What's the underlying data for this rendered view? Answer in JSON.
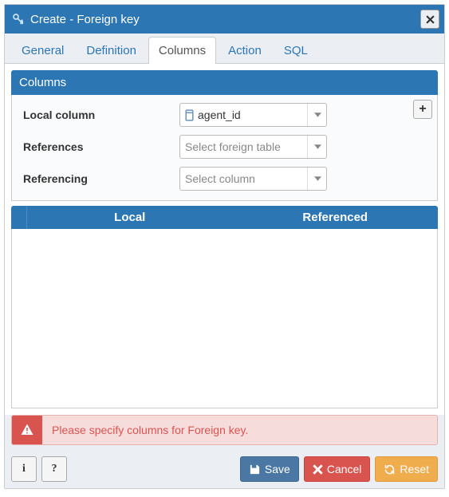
{
  "dialog": {
    "title": "Create - Foreign key"
  },
  "tabs": [
    {
      "label": "General",
      "active": false
    },
    {
      "label": "Definition",
      "active": false
    },
    {
      "label": "Columns",
      "active": true
    },
    {
      "label": "Action",
      "active": false
    },
    {
      "label": "SQL",
      "active": false
    }
  ],
  "section": {
    "title": "Columns"
  },
  "form": {
    "local_column": {
      "label": "Local column",
      "value": "agent_id"
    },
    "references": {
      "label": "References",
      "placeholder": "Select foreign table"
    },
    "referencing": {
      "label": "Referencing",
      "placeholder": "Select column"
    }
  },
  "table": {
    "col_local": "Local",
    "col_referenced": "Referenced"
  },
  "alert": {
    "message": "Please specify columns for Foreign key."
  },
  "buttons": {
    "info": "i",
    "help": "?",
    "save": "Save",
    "cancel": "Cancel",
    "reset": "Reset"
  }
}
